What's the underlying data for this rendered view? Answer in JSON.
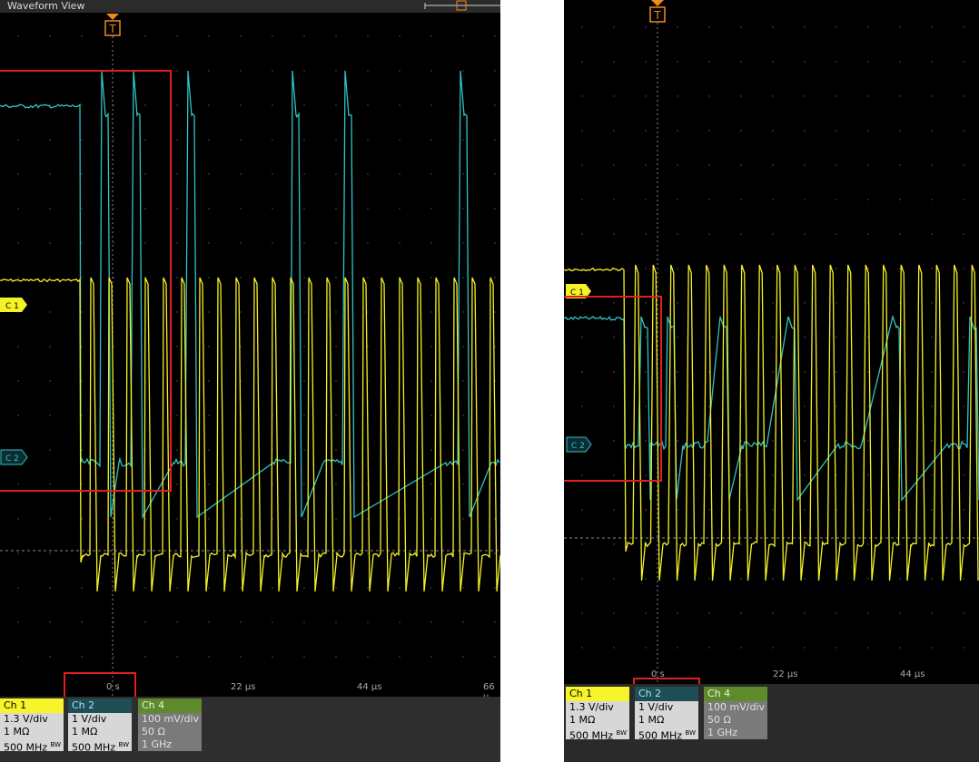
{
  "left": {
    "title": "Waveform View",
    "trigger_label": "T",
    "ticks": [
      "0 s",
      "22 µs",
      "44 µs",
      "66 µ"
    ],
    "ch1_marker": "C 1",
    "ch2_marker": "C 2"
  },
  "right": {
    "trigger_label": "T",
    "ticks": [
      "0 s",
      "22 µs",
      "44 µs"
    ],
    "ch1_marker": "C 1",
    "ch2_marker": "C 2"
  },
  "badges": {
    "ch1": {
      "label": "Ch 1",
      "scale": "1.3 V/div",
      "impedance": "1 MΩ",
      "bandwidth": "500 MHz",
      "bw": "BW"
    },
    "ch2": {
      "label": "Ch 2",
      "scale": "1 V/div",
      "impedance": "1 MΩ",
      "bandwidth": "500 MHz",
      "bw": "BW"
    },
    "ch4": {
      "label": "Ch 4",
      "scale": "100 mV/div",
      "impedance": "50 Ω",
      "bandwidth": "1 GHz"
    }
  },
  "colors": {
    "ch1": "#f5f226",
    "ch2": "#2fc3c8",
    "highlight": "#e02020",
    "grid_dot": "#5a5a5a"
  }
}
